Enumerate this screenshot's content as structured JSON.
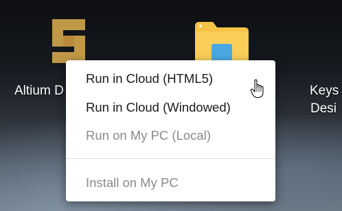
{
  "desktop": {
    "apps": [
      {
        "label": "Altium D",
        "icon": "altium-logo-icon"
      },
      {
        "label": "",
        "icon": "folder-icon"
      },
      {
        "label_line1": "Keys",
        "label_line2": "Desi"
      }
    ]
  },
  "context_menu": {
    "items": [
      {
        "label": "Run in Cloud (HTML5)",
        "enabled": true
      },
      {
        "label": "Run in Cloud (Windowed)",
        "enabled": true
      },
      {
        "label": "Run on My PC (Local)",
        "enabled": false
      },
      {
        "label": "Install on My PC",
        "enabled": false
      }
    ]
  },
  "colors": {
    "altium_gold": "#c9a04a",
    "folder_yellow": "#f6c447",
    "folder_blue": "#4aa8e0",
    "menu_text": "#1a1a1a",
    "menu_text_disabled": "#8a8a8a"
  },
  "cursor": {
    "icon": "hand-pointer-icon"
  }
}
